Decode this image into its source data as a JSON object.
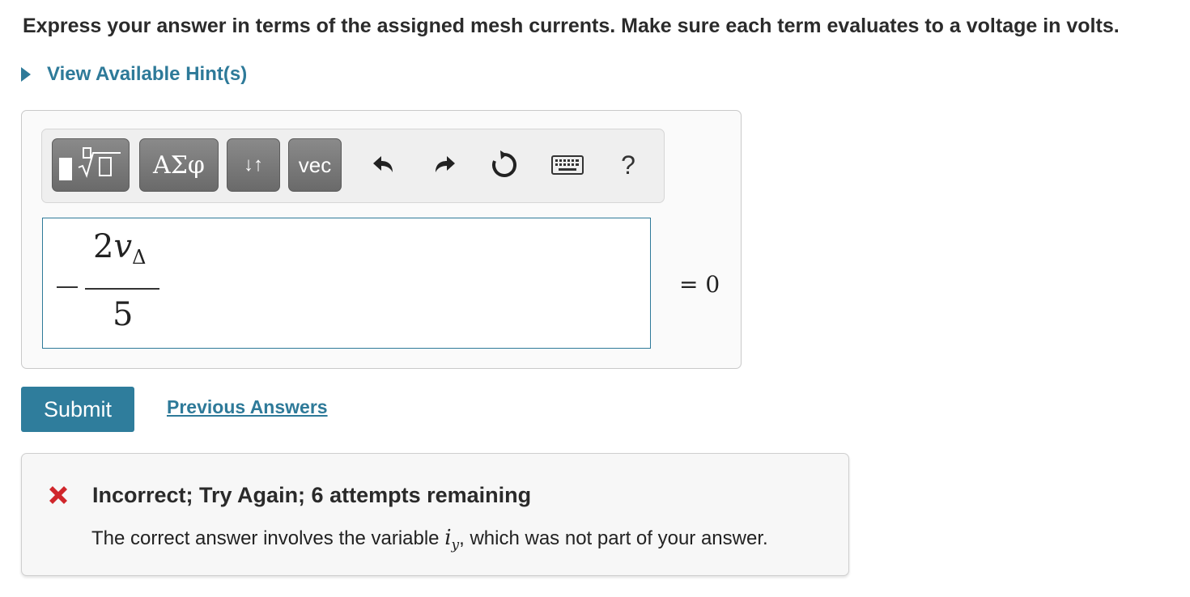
{
  "instruction": "Express your answer in terms of the assigned mesh currents.  Make sure each term evaluates to a voltage in volts.",
  "hint": {
    "label": "View Available Hint(s)"
  },
  "toolbar": {
    "templates_icon": "fraction-sqrt-icon",
    "greek_label": "ΑΣφ",
    "arrows_label": "↓↑",
    "vec_label": "vec",
    "undo_icon": "undo-icon",
    "redo_icon": "redo-icon",
    "reset_icon": "reset-icon",
    "keyboard_icon": "keyboard-icon",
    "help_label": "?"
  },
  "editor": {
    "sign": "−",
    "numerator_coef": "2",
    "numerator_var": "v",
    "numerator_sub": "Δ",
    "denominator": "5",
    "rhs": "= 0"
  },
  "submit_label": "Submit",
  "previous_answers_label": "Previous Answers",
  "feedback": {
    "status": "incorrect",
    "title": "Incorrect; Try Again; 6 attempts remaining",
    "message_before": "The correct answer involves the variable ",
    "variable": "i",
    "variable_sub": "y",
    "message_after": ", which was not part of your answer.",
    "status_color": "#d0262b"
  },
  "colors": {
    "accent": "#2e7a99",
    "button": "#2f7d9c"
  }
}
